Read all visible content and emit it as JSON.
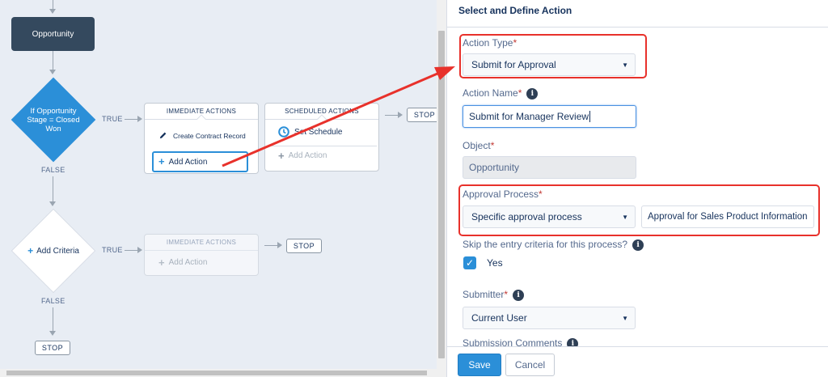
{
  "canvas": {
    "object_node": "Opportunity",
    "criteria_node": "If Opportunity Stage = Closed Won",
    "criteria_line1": "If Opportunity",
    "criteria_line2": "Stage = Closed",
    "criteria_line3": "Won",
    "true_label": "TRUE",
    "false_label": "FALSE",
    "immediate_actions_header": "IMMEDIATE ACTIONS",
    "scheduled_actions_header": "SCHEDULED ACTIONS",
    "create_contract_record": "Create Contract Record",
    "add_action": "Add Action",
    "set_schedule": "Set Schedule",
    "stop": "STOP",
    "add_criteria": "Add Criteria",
    "icons": {
      "pencil": "pencil-icon",
      "clock": "clock-icon",
      "plus": "plus-icon"
    }
  },
  "panel": {
    "title": "Select and Define Action",
    "action_type": {
      "label": "Action Type",
      "required": "*",
      "value": "Submit for Approval"
    },
    "action_name": {
      "label": "Action Name",
      "required": "*",
      "value": "Submit for Manager Review"
    },
    "object": {
      "label": "Object",
      "required": "*",
      "value": "Opportunity"
    },
    "approval_process": {
      "label": "Approval Process",
      "required": "*",
      "value": "Specific approval process",
      "name_value": "Approval for Sales Product Information"
    },
    "skip_criteria": {
      "label": "Skip the entry criteria for this process?",
      "checkbox_label": "Yes",
      "checked": true
    },
    "submitter": {
      "label": "Submitter",
      "required": "*",
      "value": "Current User"
    },
    "submission_comments": {
      "label": "Submission Comments"
    },
    "save_label": "Save",
    "cancel_label": "Cancel"
  },
  "colors": {
    "accent": "#2b8fd8",
    "highlight": "#e8312b",
    "dark_node": "#34495e"
  }
}
